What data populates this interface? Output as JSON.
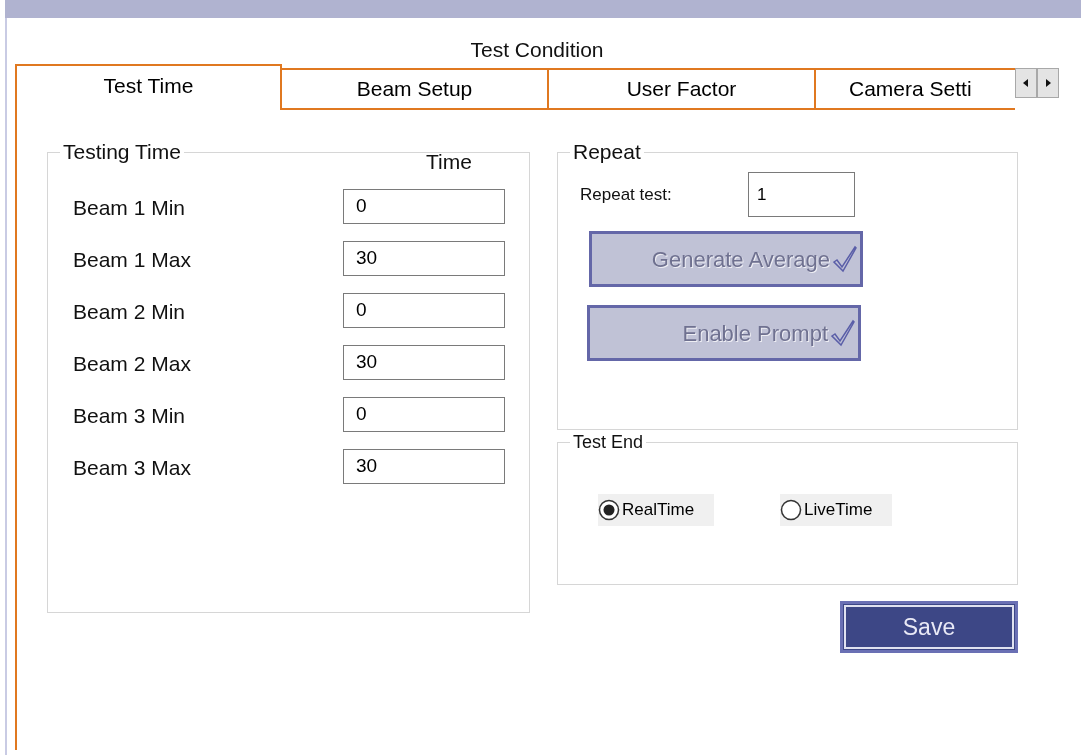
{
  "window": {
    "title": "Test Condition"
  },
  "tabs": [
    {
      "label": "Test Time",
      "selected": true
    },
    {
      "label": "Beam Setup",
      "selected": false
    },
    {
      "label": "User Factor",
      "selected": false
    },
    {
      "label": "Camera Setti",
      "selected": false
    }
  ],
  "testing_time": {
    "title": "Testing Time",
    "column": "Time",
    "rows": [
      {
        "label": "Beam 1 Min",
        "value": "0"
      },
      {
        "label": "Beam 1 Max",
        "value": "30"
      },
      {
        "label": "Beam 2 Min",
        "value": "0"
      },
      {
        "label": "Beam 2 Max",
        "value": "30"
      },
      {
        "label": "Beam 3 Min",
        "value": "0"
      },
      {
        "label": "Beam 3 Max",
        "value": "30"
      }
    ]
  },
  "repeat": {
    "title": "Repeat",
    "label": "Repeat test:",
    "value": "1",
    "buttons": [
      {
        "label": "Generate Average",
        "disabled": true
      },
      {
        "label": "Enable Prompt",
        "disabled": true
      }
    ]
  },
  "test_end": {
    "title": "Test End",
    "options": [
      {
        "label": "RealTime",
        "selected": true
      },
      {
        "label": "LiveTime",
        "selected": false
      }
    ]
  },
  "save": {
    "label": "Save",
    "disabled": false
  }
}
